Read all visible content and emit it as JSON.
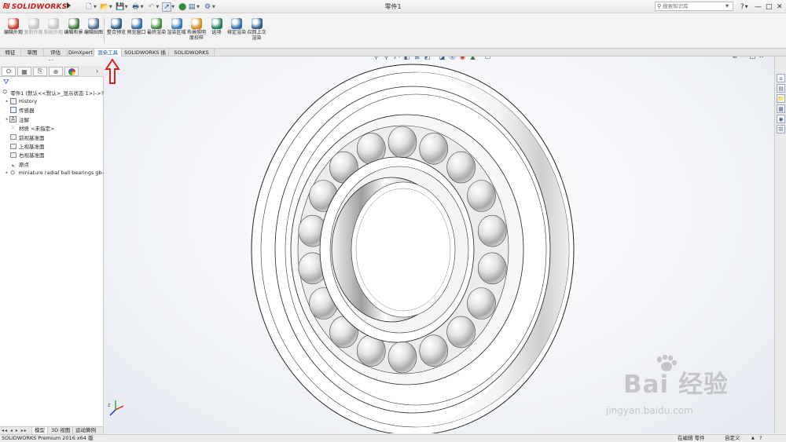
{
  "app": {
    "logo_text": "SOLIDWORKS",
    "document_title": "零件1"
  },
  "search": {
    "placeholder": "搜索知识库"
  },
  "window_controls": [
    "?",
    "—",
    "□",
    "✕"
  ],
  "ribbon": {
    "groups": [
      [
        {
          "label": "编辑外观",
          "enabled": true,
          "color": "#c43a2e"
        },
        {
          "label": "复制外观",
          "enabled": false,
          "color": "#888888"
        },
        {
          "label": "粘贴外观",
          "enabled": false,
          "color": "#888888"
        },
        {
          "label": "编辑布景",
          "enabled": true,
          "color": "#3e7a3a"
        },
        {
          "label": "编辑贴图",
          "enabled": true,
          "color": "#4d6a8f"
        }
      ],
      [
        {
          "label": "整合预览",
          "enabled": true,
          "color": "#2b5a8a"
        },
        {
          "label": "预览窗口",
          "enabled": true,
          "color": "#2b6aa8"
        },
        {
          "label": "最终渲染",
          "enabled": true,
          "color": "#3a8a3a"
        },
        {
          "label": "渲染区域",
          "enabled": true,
          "color": "#3577b8"
        },
        {
          "label": "布景照明度校样",
          "enabled": true,
          "color": "#d18b1c"
        },
        {
          "label": "选项",
          "enabled": true,
          "color": "#1e7a5a"
        },
        {
          "label": "排定渲染",
          "enabled": true,
          "color": "#2b6aa8"
        },
        {
          "label": "召回上次渲染",
          "enabled": true,
          "color": "#2b5a8a"
        }
      ]
    ]
  },
  "tabs": [
    {
      "label": "特征",
      "active": false
    },
    {
      "label": "草图",
      "active": false
    },
    {
      "label": "评估",
      "active": false
    },
    {
      "label": "DimXpert",
      "active": false
    },
    {
      "label": "渲染工具",
      "active": true
    },
    {
      "label": "SOLIDWORKS 插件",
      "active": false
    },
    {
      "label": "SOLIDWORKS MBD",
      "active": false
    }
  ],
  "feature_tree": {
    "root": "零件1 (默认<<默认>_显示状态 1>)->?",
    "items": [
      {
        "label": "History",
        "expandable": true,
        "icon": "history-icon"
      },
      {
        "label": "传感器",
        "expandable": false,
        "icon": "sensor-icon"
      },
      {
        "label": "注解",
        "expandable": true,
        "icon": "annotation-icon"
      },
      {
        "label": "材质 <未指定>",
        "expandable": false,
        "icon": "material-icon"
      },
      {
        "label": "前视基准面",
        "expandable": false,
        "icon": "plane-icon"
      },
      {
        "label": "上视基准面",
        "expandable": false,
        "icon": "plane-icon"
      },
      {
        "label": "右视基准面",
        "expandable": false,
        "icon": "plane-icon"
      },
      {
        "label": "原点",
        "expandable": false,
        "icon": "origin-icon"
      },
      {
        "label": "miniature radial ball bearings gb-",
        "expandable": true,
        "icon": "part-icon"
      }
    ]
  },
  "bottom_tabs": [
    "模型",
    "3D 视图",
    "运动算例 1"
  ],
  "status": {
    "app_version": "SOLIDWORKS Premium 2016 x64 版",
    "editing": "在编辑 零件",
    "units": "自定义"
  },
  "watermark": {
    "main": "Bai 经验",
    "sub": "jingyan.baidu.com"
  },
  "colors": {
    "accent": "#1e5ca8",
    "logo_red": "#cc1b1b",
    "annotation_arrow": "#d9201c"
  }
}
